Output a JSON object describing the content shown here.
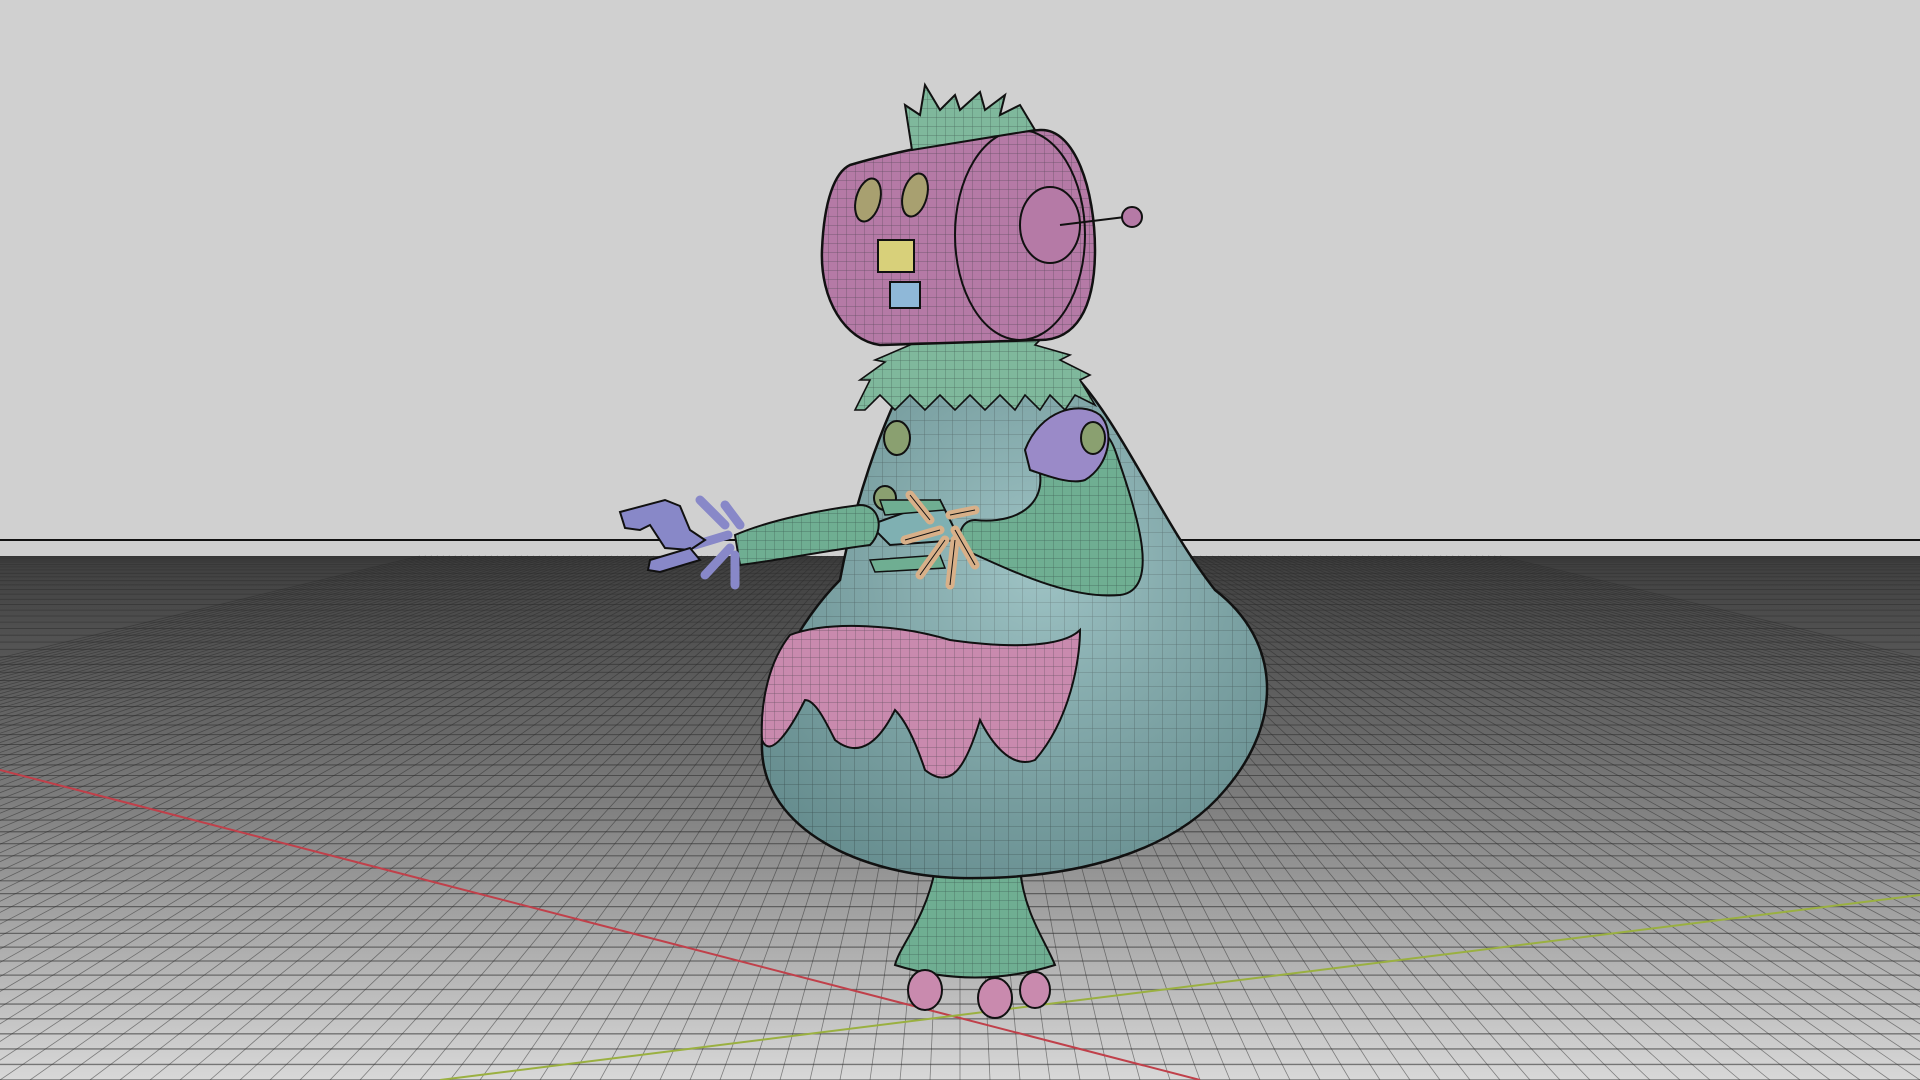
{
  "viewport": {
    "background_top": "#d0d0d0",
    "background_horizon": "#c8c8c8",
    "floor_far": "#4a4a4a",
    "floor_near": "#d6d6d6",
    "grid_line": "#2a2a2a",
    "axis_x_color": "#c0404a",
    "axis_z_color": "#9ab040",
    "horizon_line_color": "#111111"
  },
  "model": {
    "wire_color": "#1f2a2a",
    "materials": {
      "head": "#b57aa6",
      "body": "#7fb0b2",
      "arms": "#6fae92",
      "sleeve": "#9a8ac8",
      "apron": "#c98aae",
      "hand_left": "#8888c8",
      "fingers": "#d8b089",
      "eyes": "#a8a070",
      "mouth_top": "#d8d07a",
      "mouth_bottom": "#8fb8d8",
      "base": "#6fae92",
      "feet": "#c98aae",
      "collar": "#7fb89c",
      "hair": "#7fb89c",
      "buttons": "#8aa070"
    }
  }
}
